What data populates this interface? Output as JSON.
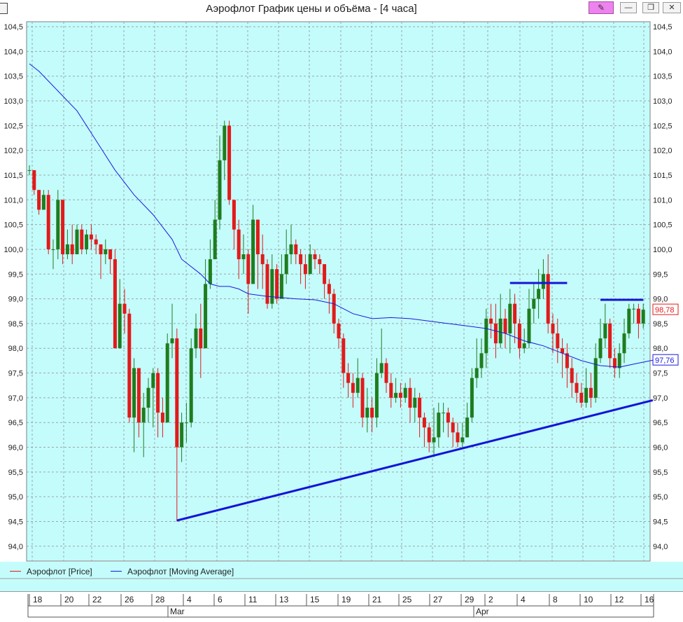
{
  "window": {
    "title": "Аэрофлот График цены и объёма - [4 часа]",
    "pin_icon": "pencil-icon",
    "minimize_icon": "minimize-icon",
    "maximize_icon": "restore-icon",
    "close_icon": "close-icon"
  },
  "colors": {
    "background": "#c4fcfc",
    "up_candle": "#1e7d1e",
    "down_candle": "#e21a1a",
    "moving_average": "#1a1ae0",
    "trend_lines": "#1414d8",
    "grid": "#9aa8a8"
  },
  "legend": {
    "price_label": "Аэрофлот [Price]",
    "ma_label": "Аэрофлот [Moving Average]"
  },
  "chart_data": {
    "type": "candlestick",
    "title": "Аэрофлот График цены и объёма - [4 часа]",
    "ylim": [
      93.7,
      104.6
    ],
    "y_ticks": [
      "104,5",
      "104,0",
      "103,5",
      "103,0",
      "102,5",
      "102,0",
      "101,5",
      "101,0",
      "100,5",
      "100,0",
      "99,5",
      "99,0",
      "98,5",
      "98,0",
      "97,5",
      "97,0",
      "96,5",
      "96,0",
      "95,5",
      "95,0",
      "94,5",
      "94,0"
    ],
    "grid": true,
    "last_price_label": "98,78",
    "last_ma_label": "97,76",
    "x_tick_labels": [
      "18",
      "20",
      "22",
      "26",
      "28",
      "4",
      "6",
      "11",
      "13",
      "15",
      "19",
      "21",
      "25",
      "27",
      "29",
      "2",
      "4",
      "8",
      "10",
      "12",
      "16"
    ],
    "x_month_labels": [
      "Mar",
      "Apr"
    ],
    "series": [
      {
        "name": "Аэрофлот [Price]",
        "candles": [
          [
            101.6,
            101.6,
            101.7,
            101.5
          ],
          [
            101.6,
            101.2,
            101.6,
            101.1
          ],
          [
            101.2,
            100.8,
            101.2,
            100.7
          ],
          [
            100.8,
            101.1,
            101.2,
            100.8
          ],
          [
            101.1,
            100.0,
            101.2,
            99.9
          ],
          [
            100.0,
            100.0,
            100.2,
            99.6
          ],
          [
            100.0,
            101.0,
            101.2,
            99.8
          ],
          [
            101.0,
            99.9,
            101.0,
            99.7
          ],
          [
            99.9,
            100.1,
            100.4,
            99.8
          ],
          [
            100.1,
            99.9,
            100.5,
            99.7
          ],
          [
            99.9,
            100.4,
            100.5,
            99.9
          ],
          [
            100.4,
            100.0,
            100.5,
            99.9
          ],
          [
            100.0,
            100.3,
            100.4,
            99.9
          ],
          [
            100.3,
            100.2,
            100.5,
            100.0
          ],
          [
            100.2,
            100.1,
            100.3,
            99.9
          ],
          [
            100.1,
            99.9,
            100.1,
            99.4
          ],
          [
            99.9,
            100.0,
            100.2,
            99.7
          ],
          [
            100.0,
            99.8,
            100.0,
            99.5
          ],
          [
            99.8,
            98.0,
            100.0,
            98.0
          ],
          [
            98.0,
            98.9,
            99.4,
            98.0
          ],
          [
            98.9,
            98.7,
            99.2,
            98.3
          ],
          [
            98.7,
            96.6,
            98.8,
            96.5
          ],
          [
            96.6,
            97.6,
            97.8,
            95.9
          ],
          [
            97.6,
            96.5,
            97.6,
            96.2
          ],
          [
            96.5,
            96.8,
            97.1,
            95.8
          ],
          [
            96.8,
            97.2,
            97.4,
            96.5
          ],
          [
            97.2,
            97.5,
            97.6,
            96.4
          ],
          [
            97.5,
            96.7,
            97.6,
            96.2
          ],
          [
            96.7,
            96.5,
            97.0,
            96.2
          ],
          [
            96.5,
            98.1,
            98.3,
            96.5
          ],
          [
            98.1,
            98.2,
            98.9,
            97.8
          ],
          [
            98.2,
            96.0,
            98.4,
            94.5
          ],
          [
            96.0,
            96.5,
            96.7,
            95.7
          ],
          [
            96.5,
            96.5,
            96.9,
            96.1
          ],
          [
            96.5,
            98.0,
            98.2,
            96.4
          ],
          [
            98.0,
            98.4,
            98.7,
            97.8
          ],
          [
            98.4,
            98.0,
            98.9,
            97.4
          ],
          [
            98.0,
            99.3,
            99.8,
            98.0
          ],
          [
            99.3,
            99.8,
            100.2,
            99.2
          ],
          [
            99.8,
            100.6,
            101.0,
            99.8
          ],
          [
            100.6,
            101.8,
            102.3,
            100.4
          ],
          [
            101.8,
            102.5,
            102.6,
            101.4
          ],
          [
            102.5,
            101.0,
            102.6,
            100.9
          ],
          [
            101.0,
            100.4,
            101.0,
            100.0
          ],
          [
            100.4,
            99.8,
            100.6,
            99.4
          ],
          [
            99.8,
            99.9,
            100.3,
            99.5
          ],
          [
            99.9,
            99.3,
            100.0,
            98.7
          ],
          [
            99.3,
            100.6,
            100.9,
            99.3
          ],
          [
            100.6,
            99.9,
            100.6,
            99.2
          ],
          [
            99.9,
            99.7,
            100.3,
            99.2
          ],
          [
            99.7,
            98.9,
            99.8,
            98.8
          ],
          [
            98.9,
            99.6,
            99.9,
            98.8
          ],
          [
            99.6,
            99.0,
            99.7,
            98.9
          ],
          [
            99.0,
            99.5,
            99.9,
            99.0
          ],
          [
            99.5,
            99.9,
            100.4,
            99.3
          ],
          [
            99.9,
            100.1,
            100.5,
            99.7
          ],
          [
            100.1,
            99.9,
            100.2,
            99.7
          ],
          [
            99.9,
            99.7,
            100.0,
            99.3
          ],
          [
            99.7,
            99.5,
            99.9,
            99.2
          ],
          [
            99.5,
            99.9,
            100.1,
            99.5
          ],
          [
            99.9,
            99.8,
            100.0,
            99.6
          ],
          [
            99.8,
            99.7,
            99.9,
            99.5
          ],
          [
            99.7,
            99.3,
            99.7,
            99.0
          ],
          [
            99.3,
            99.1,
            99.4,
            98.7
          ],
          [
            99.1,
            98.5,
            99.2,
            98.3
          ],
          [
            98.5,
            98.2,
            98.6,
            98.0
          ],
          [
            98.2,
            97.5,
            98.3,
            97.2
          ],
          [
            97.5,
            97.3,
            97.7,
            97.0
          ],
          [
            97.3,
            97.1,
            97.5,
            96.8
          ],
          [
            97.1,
            97.4,
            97.8,
            97.0
          ],
          [
            97.4,
            96.6,
            97.5,
            96.4
          ],
          [
            96.6,
            96.8,
            97.2,
            96.3
          ],
          [
            96.8,
            96.6,
            97.0,
            96.3
          ],
          [
            96.6,
            97.5,
            97.8,
            96.4
          ],
          [
            97.5,
            97.7,
            98.4,
            97.4
          ],
          [
            97.7,
            97.3,
            97.8,
            97.1
          ],
          [
            97.3,
            97.0,
            97.5,
            96.8
          ],
          [
            97.0,
            97.1,
            97.4,
            96.9
          ],
          [
            97.1,
            97.0,
            97.3,
            96.8
          ],
          [
            97.0,
            97.2,
            97.3,
            96.9
          ],
          [
            97.2,
            96.8,
            97.4,
            96.5
          ],
          [
            96.8,
            97.0,
            97.2,
            96.5
          ],
          [
            97.0,
            96.6,
            97.1,
            96.2
          ],
          [
            96.6,
            96.4,
            96.7,
            96.0
          ],
          [
            96.4,
            96.1,
            96.5,
            95.9
          ],
          [
            96.1,
            96.2,
            96.8,
            95.8
          ],
          [
            96.2,
            96.7,
            96.9,
            96.0
          ],
          [
            96.7,
            96.7,
            96.9,
            96.3
          ],
          [
            96.7,
            96.5,
            96.8,
            96.2
          ],
          [
            96.5,
            96.3,
            96.6,
            96.0
          ],
          [
            96.3,
            96.1,
            96.5,
            96.0
          ],
          [
            96.1,
            96.2,
            96.5,
            96.0
          ],
          [
            96.2,
            96.6,
            96.9,
            96.2
          ],
          [
            96.6,
            97.4,
            97.6,
            96.5
          ],
          [
            97.4,
            97.6,
            98.2,
            97.2
          ],
          [
            97.6,
            97.9,
            98.2,
            97.4
          ],
          [
            97.9,
            98.6,
            98.8,
            97.6
          ],
          [
            98.6,
            98.5,
            98.9,
            98.2
          ],
          [
            98.5,
            98.1,
            98.9,
            97.8
          ],
          [
            98.1,
            98.6,
            99.1,
            98.0
          ],
          [
            98.6,
            98.3,
            98.8,
            98.0
          ],
          [
            98.3,
            98.9,
            99.2,
            97.9
          ],
          [
            98.9,
            98.5,
            99.1,
            98.1
          ],
          [
            98.5,
            98.0,
            98.6,
            97.8
          ],
          [
            98.0,
            98.1,
            98.4,
            97.9
          ],
          [
            98.1,
            98.8,
            99.2,
            98.0
          ],
          [
            98.8,
            99.0,
            99.3,
            98.5
          ],
          [
            99.0,
            99.2,
            99.6,
            98.6
          ],
          [
            99.2,
            99.5,
            99.8,
            99.0
          ],
          [
            99.5,
            98.5,
            99.9,
            98.3
          ],
          [
            98.5,
            98.3,
            98.7,
            97.9
          ],
          [
            98.3,
            98.0,
            98.6,
            97.7
          ],
          [
            98.0,
            97.9,
            98.2,
            97.4
          ],
          [
            97.9,
            97.6,
            98.1,
            97.2
          ],
          [
            97.6,
            97.3,
            97.8,
            97.0
          ],
          [
            97.3,
            97.1,
            97.5,
            96.9
          ],
          [
            97.1,
            96.9,
            97.3,
            96.8
          ],
          [
            96.9,
            97.2,
            97.6,
            96.8
          ],
          [
            97.2,
            97.0,
            97.5,
            96.8
          ],
          [
            97.0,
            97.8,
            98.1,
            96.9
          ],
          [
            97.8,
            98.2,
            98.6,
            97.7
          ],
          [
            98.2,
            98.5,
            98.9,
            98.0
          ],
          [
            98.5,
            97.8,
            98.6,
            97.6
          ],
          [
            97.8,
            97.6,
            98.0,
            97.4
          ],
          [
            97.6,
            97.9,
            98.1,
            97.4
          ],
          [
            97.9,
            98.3,
            98.6,
            97.7
          ],
          [
            98.3,
            98.8,
            98.9,
            98.2
          ],
          [
            98.8,
            98.8,
            98.9,
            98.5
          ],
          [
            98.8,
            98.5,
            98.9,
            98.2
          ],
          [
            98.5,
            98.78,
            98.9,
            98.4
          ]
        ]
      },
      {
        "name": "Аэрофлот [Moving Average]",
        "points": [
          [
            0,
            103.75
          ],
          [
            2,
            103.6
          ],
          [
            6,
            103.2
          ],
          [
            10,
            102.8
          ],
          [
            14,
            102.2
          ],
          [
            18,
            101.6
          ],
          [
            22,
            101.1
          ],
          [
            26,
            100.7
          ],
          [
            30,
            100.2
          ],
          [
            32,
            99.8
          ],
          [
            36,
            99.5
          ],
          [
            38,
            99.3
          ],
          [
            40,
            99.25
          ],
          [
            42,
            99.25
          ],
          [
            44,
            99.2
          ],
          [
            46,
            99.1
          ],
          [
            50,
            99.05
          ],
          [
            56,
            99.0
          ],
          [
            60,
            98.98
          ],
          [
            64,
            98.9
          ],
          [
            68,
            98.7
          ],
          [
            72,
            98.6
          ],
          [
            76,
            98.62
          ],
          [
            80,
            98.6
          ],
          [
            84,
            98.55
          ],
          [
            88,
            98.5
          ],
          [
            92,
            98.45
          ],
          [
            96,
            98.4
          ],
          [
            100,
            98.3
          ],
          [
            104,
            98.15
          ],
          [
            108,
            98.05
          ],
          [
            112,
            97.9
          ],
          [
            116,
            97.75
          ],
          [
            120,
            97.65
          ],
          [
            124,
            97.62
          ],
          [
            128,
            97.7
          ],
          [
            131,
            97.76
          ]
        ]
      }
    ],
    "annotations": [
      {
        "type": "trend_line",
        "x1": 31,
        "y1": 94.52,
        "x2": 131,
        "y2": 96.95
      },
      {
        "type": "horizontal_line",
        "x1": 101,
        "x2": 113,
        "y": 99.32
      },
      {
        "type": "horizontal_line",
        "x1": 120,
        "x2": 129,
        "y": 98.98
      }
    ]
  }
}
